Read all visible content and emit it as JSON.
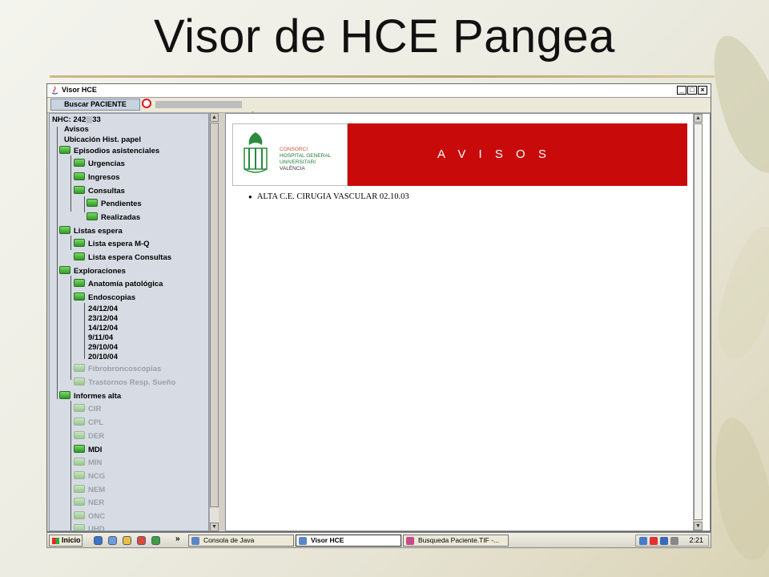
{
  "slide": {
    "title": "Visor de HCE Pangea"
  },
  "window": {
    "title": "Visor HCE",
    "buttons": {
      "minimize": "_",
      "maximize": "□",
      "close": "×"
    }
  },
  "toolbar": {
    "search_tab": "Buscar PACIENTE"
  },
  "tree": {
    "nhc_label": "NHC: 242",
    "nhc_suffix": "33",
    "items": [
      {
        "label": "Avisos"
      },
      {
        "label": "Ubicación Hist. papel"
      },
      {
        "label": "Episodios asistenciales"
      },
      {
        "label": "Urgencias"
      },
      {
        "label": "Ingresos"
      },
      {
        "label": "Consultas"
      },
      {
        "label": "Pendientes"
      },
      {
        "label": "Realizadas"
      },
      {
        "label": "Listas espera"
      },
      {
        "label": "Lista espera M-Q"
      },
      {
        "label": "Lista espera Consultas"
      },
      {
        "label": "Exploraciones"
      },
      {
        "label": "Anatomía patológica"
      },
      {
        "label": "Endoscopias"
      },
      {
        "label": "24/12/04"
      },
      {
        "label": "23/12/04"
      },
      {
        "label": "14/12/04"
      },
      {
        "label": "9/11/04"
      },
      {
        "label": "29/10/04"
      },
      {
        "label": "20/10/04"
      },
      {
        "label": "Fibrobroncoscopias"
      },
      {
        "label": "Trastornos Resp. Sueño"
      },
      {
        "label": "Informes alta"
      },
      {
        "label": "CIR"
      },
      {
        "label": "CPL"
      },
      {
        "label": "DER"
      },
      {
        "label": "MDI"
      },
      {
        "label": "MIN"
      },
      {
        "label": "NCG"
      },
      {
        "label": "NEM"
      },
      {
        "label": "NER"
      },
      {
        "label": "ONC"
      },
      {
        "label": "UHD"
      }
    ]
  },
  "content": {
    "logo": {
      "line1": "CONSORCI",
      "line2": "HOSPITAL GENERAL",
      "line3": "UNIVERSITARI",
      "line4": "VALÈNCIA"
    },
    "banner_title": "A V I S O S",
    "avisos": [
      "ALTA C.E. CIRUGIA VASCULAR 02.10.03"
    ]
  },
  "taskbar": {
    "start": "Inicio",
    "chevron": "»",
    "tasks": [
      {
        "label": "Consola de Java"
      },
      {
        "label": "Visor HCE"
      },
      {
        "label": "Busqueda Paciente.TIF -..."
      }
    ],
    "clock": "2:21"
  },
  "colors": {
    "banner_red": "#c80a0a",
    "logo_green": "#1f7a3a",
    "tree_bg": "#d6dbe4",
    "folder_green": "#2f9a26"
  }
}
